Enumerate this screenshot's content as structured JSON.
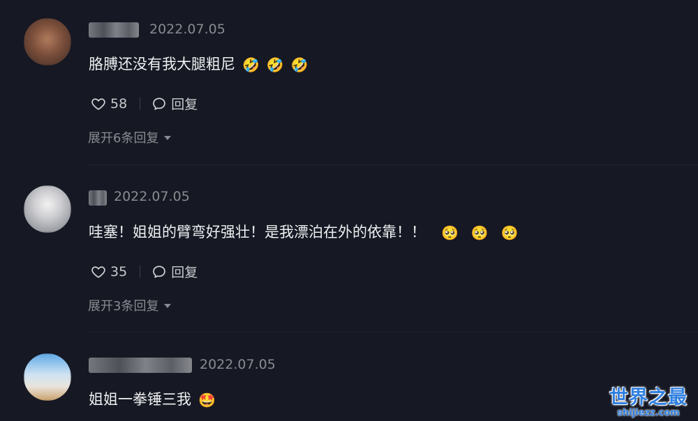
{
  "comments": [
    {
      "date": "2022.07.05",
      "text": "胳膊还没有我大腿粗尼",
      "emojis": [
        "🤣",
        "🤣",
        "🤣"
      ],
      "likes": "58",
      "reply_label": "回复",
      "expand_label": "展开6条回复"
    },
    {
      "date": "2022.07.05",
      "text": "哇塞！姐姐的臂弯好强壮！是我漂泊在外的依靠！！",
      "emojis": [
        "🥺",
        "🥺",
        "🥺"
      ],
      "likes": "35",
      "reply_label": "回复",
      "expand_label": "展开3条回复"
    },
    {
      "date": "2022.07.05",
      "text": "姐姐一拳锤三我",
      "emojis": [
        "🤩"
      ]
    }
  ],
  "watermark": {
    "title": "世界之最",
    "subtitle": "shijiezz.com"
  },
  "colors": {
    "background": "#161823",
    "muted_text": "#8a8b91",
    "watermark": "#2f7fe0"
  }
}
